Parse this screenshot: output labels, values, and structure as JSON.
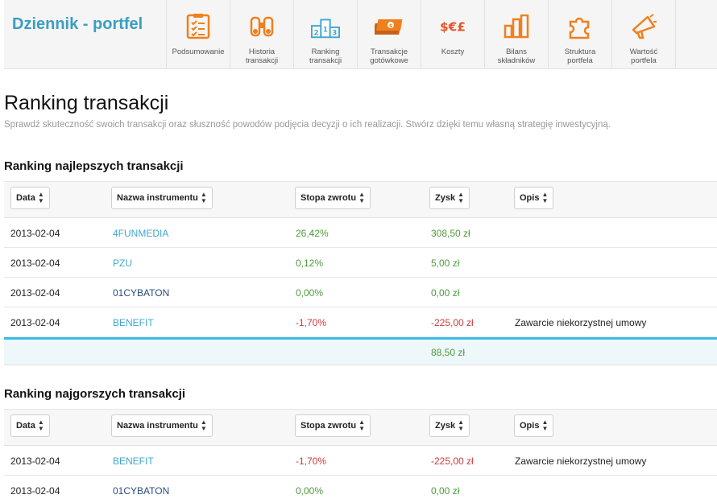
{
  "header": {
    "brand": "Dziennik - portfel",
    "nav": [
      {
        "id": "podsumowanie",
        "icon": "clipboard-checklist-icon",
        "lines": [
          "Podsumowanie"
        ]
      },
      {
        "id": "historia",
        "icon": "binoculars-icon",
        "lines": [
          "Historia",
          "transakcji"
        ]
      },
      {
        "id": "ranking",
        "icon": "podium-icon",
        "lines": [
          "Ranking",
          "transakcji"
        ]
      },
      {
        "id": "gotowkowe",
        "icon": "banknotes-icon",
        "lines": [
          "Transakcje",
          "gotówkowe"
        ]
      },
      {
        "id": "koszty",
        "icon": "currency-symbols-icon",
        "lines": [
          "Koszty"
        ]
      },
      {
        "id": "bilans",
        "icon": "bar-chart-icon",
        "lines": [
          "Bilans",
          "składników"
        ]
      },
      {
        "id": "struktura",
        "icon": "puzzle-icon",
        "lines": [
          "Struktura",
          "portfela"
        ]
      },
      {
        "id": "wartosc",
        "icon": "megaphone-icon",
        "lines": [
          "Wartość",
          "portfela"
        ]
      }
    ]
  },
  "page": {
    "title": "Ranking transakcji",
    "subtitle": "Sprawdź skuteczność swoich transakcji oraz słuszność powodów podjęcia decyzji o ich realizacji. Stwórz dzięki temu własną strategię inwestycyjną."
  },
  "colors": {
    "brand": "#3a9ec2",
    "accent_orange": "#f07f1d",
    "positive": "#4d9a3a",
    "negative": "#d03a3a",
    "summary_line": "#3bbbe3"
  },
  "columns": [
    "Data",
    "Nazwa instrumentu",
    "Stopa zwrotu",
    "Zysk",
    "Opis"
  ],
  "best": {
    "title": "Ranking najlepszych transakcji",
    "rows": [
      {
        "date": "2013-02-04",
        "name": "4FUNMEDIA",
        "name_style": "light",
        "rate": "26,42%",
        "profit": "308,50 zł",
        "sign": "pos",
        "desc": ""
      },
      {
        "date": "2013-02-04",
        "name": "PZU",
        "name_style": "light",
        "rate": "0,12%",
        "profit": "5,00 zł",
        "sign": "pos",
        "desc": ""
      },
      {
        "date": "2013-02-04",
        "name": "01CYBATON",
        "name_style": "dark",
        "rate": "0,00%",
        "profit": "0,00 zł",
        "sign": "pos",
        "desc": ""
      },
      {
        "date": "2013-02-04",
        "name": "BENEFIT",
        "name_style": "light",
        "rate": "-1,70%",
        "profit": "-225,00 zł",
        "sign": "neg",
        "desc": "Zawarcie niekorzystnej umowy"
      }
    ],
    "total": "88,50 zł"
  },
  "worst": {
    "title": "Ranking najgorszych transakcji",
    "rows": [
      {
        "date": "2013-02-04",
        "name": "BENEFIT",
        "name_style": "light",
        "rate": "-1,70%",
        "profit": "-225,00 zł",
        "sign": "neg",
        "desc": "Zawarcie niekorzystnej umowy"
      },
      {
        "date": "2013-02-04",
        "name": "01CYBATON",
        "name_style": "dark",
        "rate": "0,00%",
        "profit": "0,00 zł",
        "sign": "pos",
        "desc": ""
      }
    ]
  }
}
